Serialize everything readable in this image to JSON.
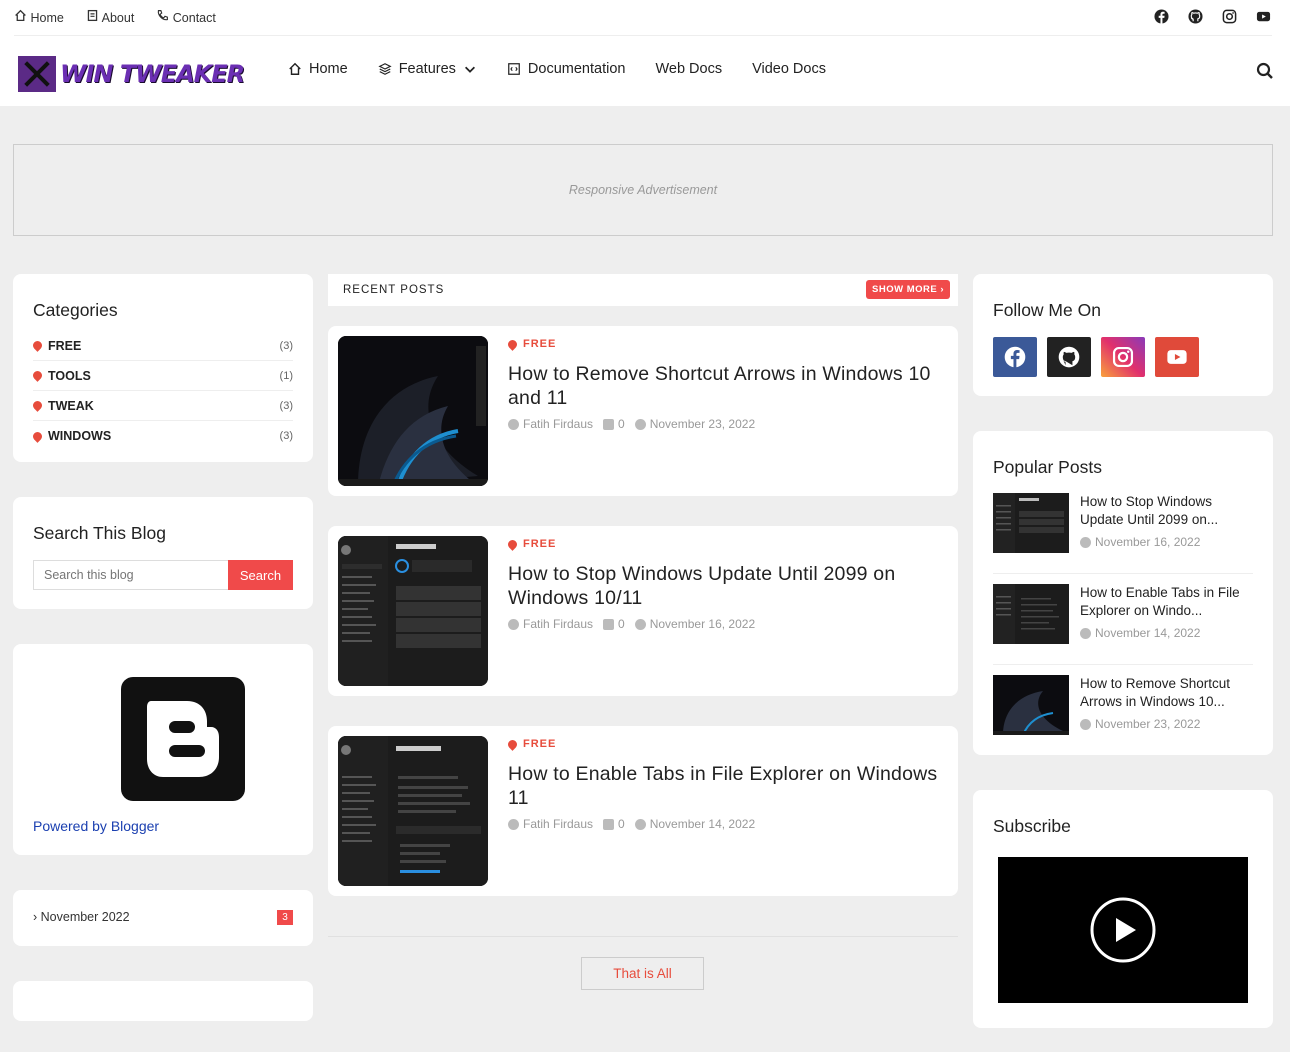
{
  "topbar": {
    "links": [
      {
        "label": "Home",
        "icon": "home-icon"
      },
      {
        "label": "About",
        "icon": "document-icon"
      },
      {
        "label": "Contact",
        "icon": "phone-icon"
      }
    ],
    "social": [
      "facebook-icon",
      "github-icon",
      "instagram-icon",
      "youtube-icon"
    ]
  },
  "header": {
    "logo_text": "WIN TWEAKER",
    "nav": [
      {
        "label": "Home"
      },
      {
        "label": "Features"
      },
      {
        "label": "Documentation"
      },
      {
        "label": "Web Docs"
      },
      {
        "label": "Video Docs"
      }
    ]
  },
  "ad": {
    "text": "Responsive Advertisement"
  },
  "categories": {
    "title": "Categories",
    "items": [
      {
        "name": "FREE",
        "count": "(3)"
      },
      {
        "name": "TOOLS",
        "count": "(1)"
      },
      {
        "name": "TWEAK",
        "count": "(3)"
      },
      {
        "name": "WINDOWS",
        "count": "(3)"
      }
    ]
  },
  "search_widget": {
    "title": "Search This Blog",
    "placeholder": "Search this blog",
    "button": "Search"
  },
  "blogger": {
    "link": "Powered by Blogger"
  },
  "archive": {
    "label": "› November 2022",
    "count": "3"
  },
  "recent": {
    "label": "RECENT POSTS",
    "more": "SHOW MORE ›",
    "posts": [
      {
        "tag": "FREE",
        "title": "How to Remove Shortcut Arrows in Windows 10 and 11",
        "author": "Fatih Firdaus",
        "comments": "0",
        "date": "November 23, 2022"
      },
      {
        "tag": "FREE",
        "title": "How to Stop Windows Update Until 2099 on Windows 10/11",
        "author": "Fatih Firdaus",
        "comments": "0",
        "date": "November 16, 2022"
      },
      {
        "tag": "FREE",
        "title": "How to Enable Tabs in File Explorer on Windows 11",
        "author": "Fatih Firdaus",
        "comments": "0",
        "date": "November 14, 2022"
      }
    ],
    "end_button": "That is All"
  },
  "follow": {
    "title": "Follow Me On"
  },
  "popular": {
    "title": "Popular Posts",
    "posts": [
      {
        "title": "How to Stop Windows Update Until 2099 on...",
        "date": "November 16, 2022"
      },
      {
        "title": "How to Enable Tabs in File Explorer on Windo...",
        "date": "November 14, 2022"
      },
      {
        "title": "How to Remove Shortcut Arrows in Windows 10...",
        "date": "November 23, 2022"
      }
    ]
  },
  "subscribe": {
    "title": "Subscribe"
  },
  "colors": {
    "accent": "#f04a4a",
    "logo": "#6b2fb3",
    "facebook": "#3b5998",
    "github": "#222222",
    "youtube": "#e04a3a"
  }
}
